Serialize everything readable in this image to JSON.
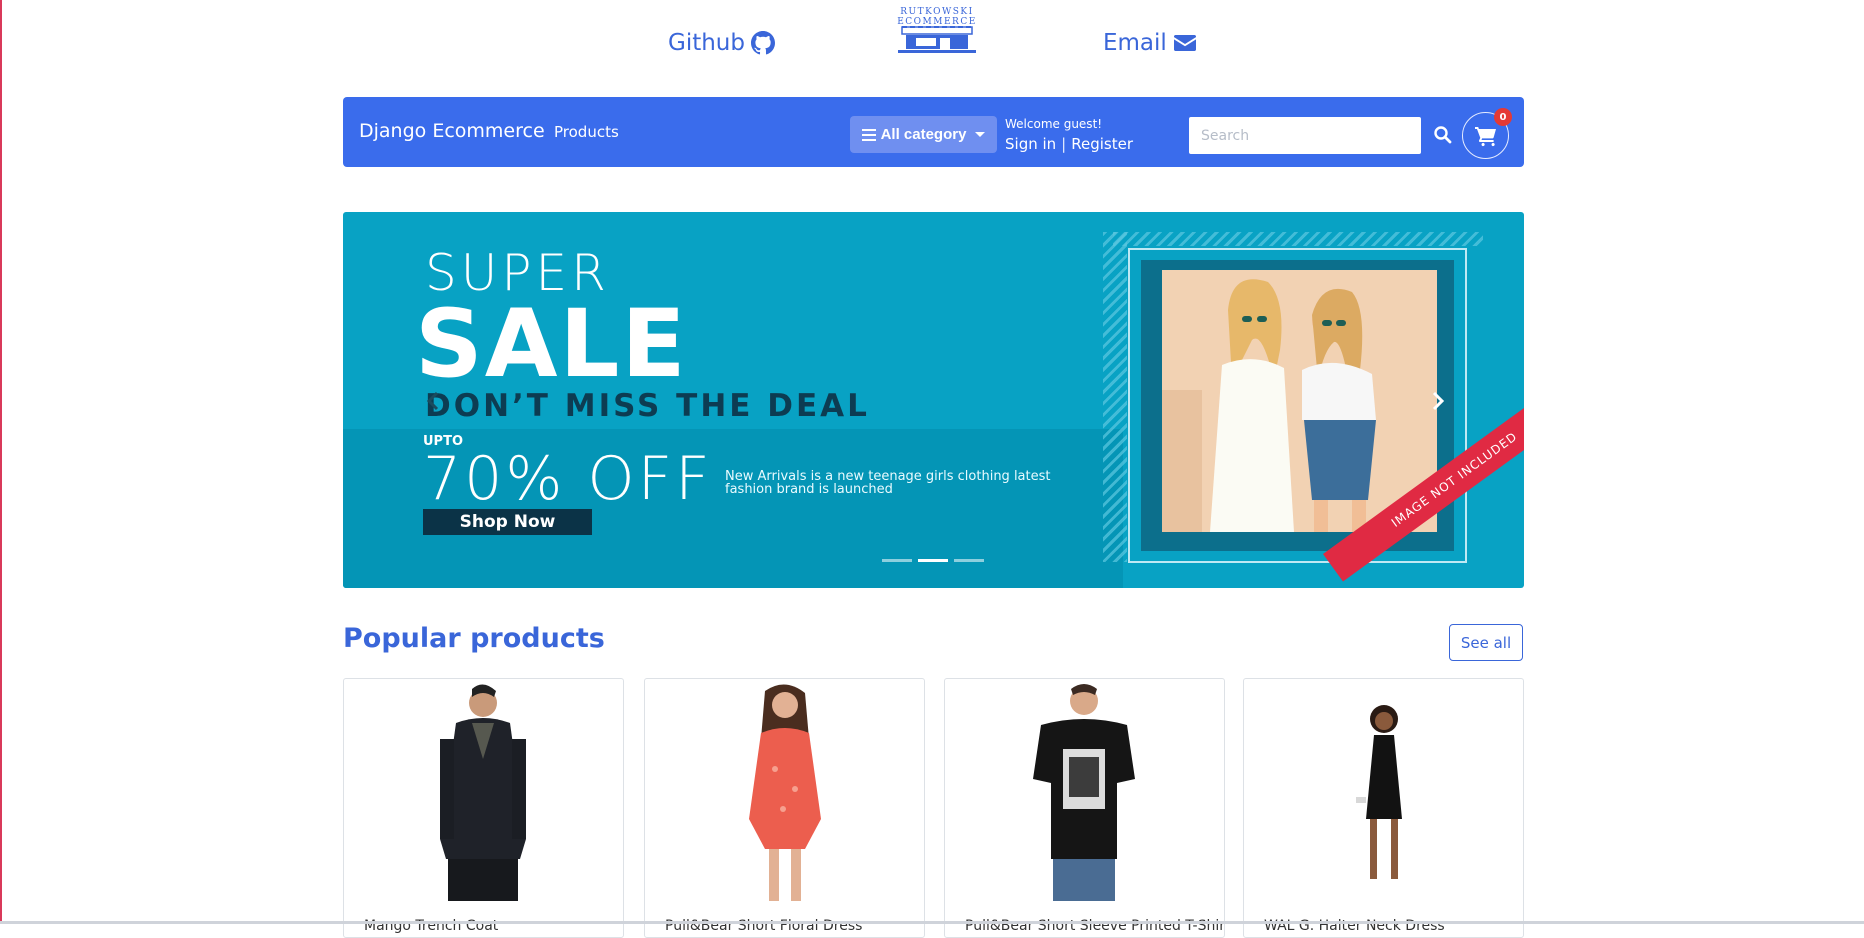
{
  "header": {
    "github_label": "Github",
    "email_label": "Email",
    "logo_line1": "RUTKOWSKI",
    "logo_line2": "ECOMMERCE"
  },
  "navbar": {
    "brand": "Django Ecommerce",
    "products_label": "Products",
    "category_button": "All category",
    "welcome": "Welcome guest!",
    "sign_in": "Sign in",
    "separator": "|",
    "register": "Register",
    "search_placeholder": "Search",
    "cart_count": "0"
  },
  "banner": {
    "line1": "SUPER",
    "line2": "SALE",
    "line3": "DON’T MISS THE DEAL",
    "upto": "UPTO",
    "discount": "70% OFF",
    "description": "New Arrivals is a new teenage girls clothing latest fashion brand is launched",
    "cta": "Shop Now",
    "ribbon": "IMAGE NOT INCLUDED",
    "slide_count": 3,
    "active_slide": 2
  },
  "popular": {
    "title": "Popular products",
    "see_all": "See all",
    "products": [
      {
        "name": "Mango Trench Coat"
      },
      {
        "name": "Pull&Bear Short Floral Dress"
      },
      {
        "name": "Pull&Bear Short Sleeve Printed T-Shirt"
      },
      {
        "name": "WAL G. Halter Neck Dress"
      }
    ]
  },
  "colors": {
    "navbar": "#3a6cec",
    "accent": "#3a66d9",
    "banner": "#08a2c4",
    "badge": "#e53935"
  },
  "icons": {
    "github": "github-icon",
    "email": "envelope-icon",
    "category": "hamburger-icon",
    "search": "search-icon",
    "cart": "cart-icon"
  }
}
